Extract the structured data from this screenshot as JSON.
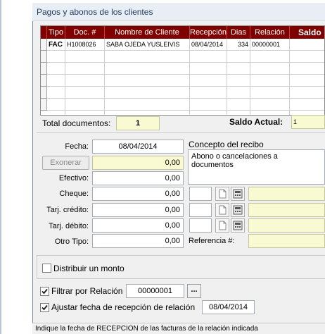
{
  "window": {
    "title": "Pagos y abonos de los clientes"
  },
  "grid": {
    "headers": [
      "Tipo",
      "Doc. #",
      "Nombre de Cliente",
      "Recepción",
      "Dias",
      "Relación",
      "Saldo"
    ],
    "rows": [
      [
        "FAC",
        "H1008026",
        "SABA OJEDA YUSLEIVIS",
        "08/04/2014",
        "334",
        "00000001",
        ""
      ]
    ]
  },
  "totals": {
    "total_docs_label": "Total documentos:",
    "total_docs_value": "1",
    "saldo_label": "Saldo Actual:",
    "saldo_value": "1"
  },
  "form": {
    "fecha_label": "Fecha:",
    "fecha_value": "08/04/2014",
    "exonerar_label": "Exonerar",
    "exonerar_value": "0,00",
    "efectivo_label": "Efectivo:",
    "efectivo_value": "0,00",
    "cheque_label": "Cheque:",
    "cheque_value": "0,00",
    "tarj_credito_label": "Tarj. crédito:",
    "tarj_credito_value": "0,00",
    "tarj_debito_label": "Tarj. débito:",
    "tarj_debito_value": "0,00",
    "otro_tipo_label": "Otro Tipo:",
    "otro_tipo_value": "0,00",
    "concepto_label": "Concepto del recibo",
    "concepto_value": "Abono o cancelaciones a documentos",
    "referencia_label": "Referencia #:"
  },
  "options": {
    "distribuir_label": "Distribuir un monto",
    "filtrar_label": "Filtrar por Relación",
    "filtrar_value": "00000001",
    "browse_label": "...",
    "ajustar_label": "Ajustar fecha de recepción de relación",
    "ajustar_value": "08/04/2014"
  },
  "status": {
    "text": "Indique la fecha de RECEPCION de las facturas de la relación indicada"
  },
  "colors": {
    "header_bg": "#800000",
    "yellow_field": "#fafad2"
  }
}
